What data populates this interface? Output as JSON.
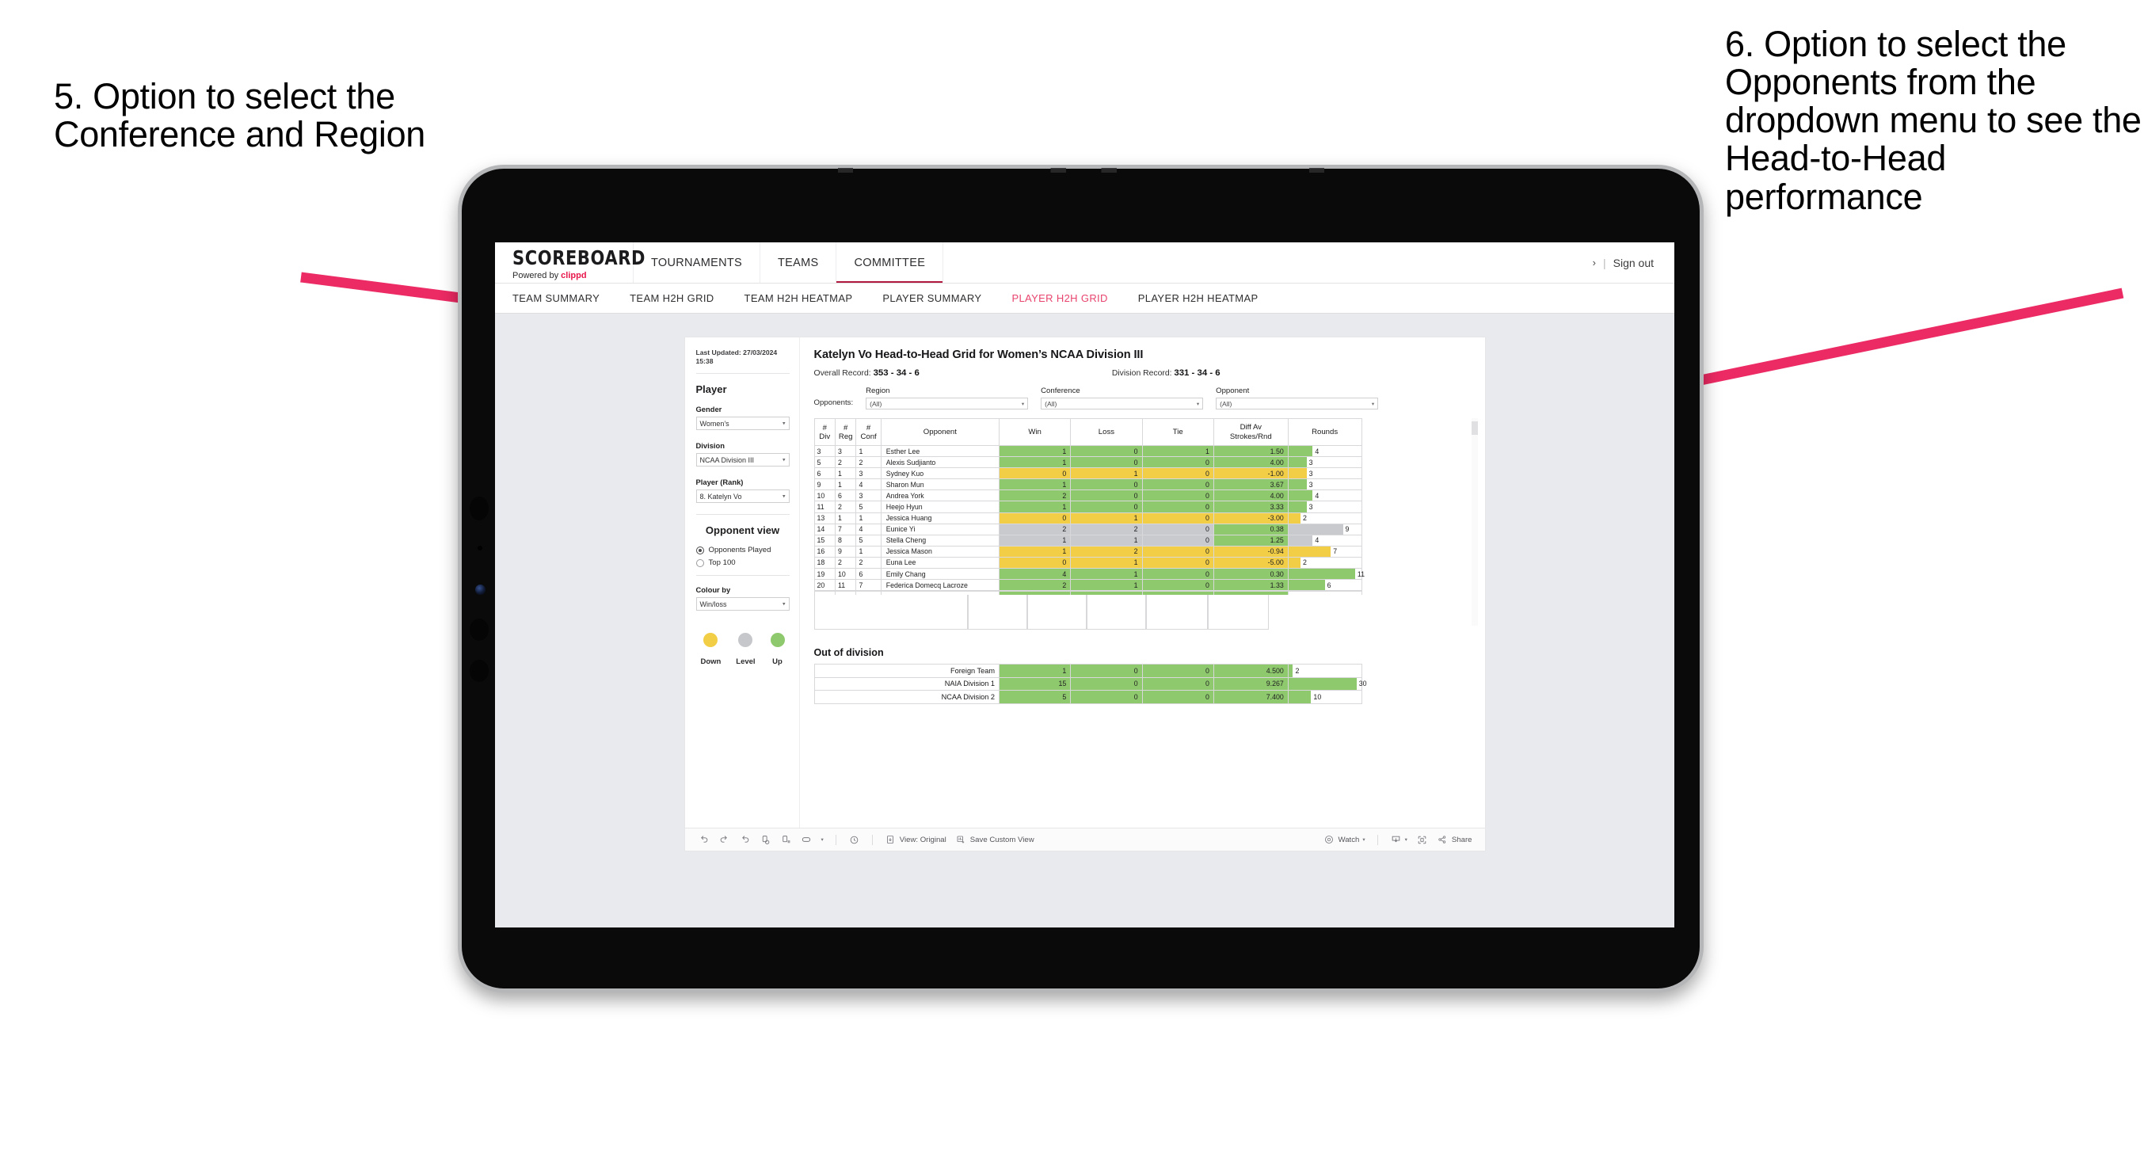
{
  "annotations": {
    "left": "5. Option to select the Conference and Region",
    "right": "6. Option to select the Opponents from the dropdown menu to see the Head-to-Head performance",
    "arrow_color": "#EC2a63"
  },
  "header": {
    "brand_title": "SCOREBOARD",
    "brand_sub_prefix": "Powered by ",
    "brand_sub_brand": "clippd",
    "nav": [
      {
        "label": "TOURNAMENTS",
        "active": false
      },
      {
        "label": "TEAMS",
        "active": false
      },
      {
        "label": "COMMITTEE",
        "active": true
      }
    ],
    "chevron": "›",
    "separator": "|",
    "sign_out": "Sign out"
  },
  "subnav": {
    "items": [
      {
        "label": "TEAM SUMMARY",
        "active": false
      },
      {
        "label": "TEAM H2H GRID",
        "active": false
      },
      {
        "label": "TEAM H2H HEATMAP",
        "active": false
      },
      {
        "label": "PLAYER SUMMARY",
        "active": false
      },
      {
        "label": "PLAYER H2H GRID",
        "active": true
      },
      {
        "label": "PLAYER H2H HEATMAP",
        "active": false
      }
    ],
    "active_color": "#e8446d"
  },
  "sidebar": {
    "last_updated": "Last Updated: 27/03/2024 15:38",
    "player_heading": "Player",
    "gender": {
      "label": "Gender",
      "value": "Women’s"
    },
    "division": {
      "label": "Division",
      "value": "NCAA Division III"
    },
    "player_rank": {
      "label": "Player (Rank)",
      "value": "8. Katelyn Vo"
    },
    "opponent_view": {
      "heading": "Opponent view",
      "options": [
        {
          "label": "Opponents Played",
          "selected": true
        },
        {
          "label": "Top 100",
          "selected": false
        }
      ]
    },
    "colour_by": {
      "label": "Colour by",
      "value": "Win/loss"
    },
    "legend": [
      {
        "caption": "Down",
        "color": "#F2CE46"
      },
      {
        "caption": "Level",
        "color": "#C5C7CB"
      },
      {
        "caption": "Up",
        "color": "#8FC96D"
      }
    ]
  },
  "main": {
    "title": "Katelyn Vo Head-to-Head Grid for Women’s NCAA Division III",
    "overall_record_label": "Overall Record:",
    "overall_record_value": "353 - 34 - 6",
    "division_record_label": "Division Record:",
    "division_record_value": "331 - 34 - 6",
    "opponents_label": "Opponents:",
    "filters": [
      {
        "label": "Region",
        "value": "(All)"
      },
      {
        "label": "Conference",
        "value": "(All)"
      },
      {
        "label": "Opponent",
        "value": "(All)"
      }
    ]
  },
  "chart_data": {
    "type": "table",
    "title": "Katelyn Vo Head-to-Head Grid for Women’s NCAA Division III",
    "columns": [
      "# Div",
      "# Reg",
      "# Conf",
      "Opponent",
      "Win",
      "Loss",
      "Tie",
      "Diff Av Strokes/Rnd",
      "Rounds"
    ],
    "rounds_max": 12,
    "rows": [
      {
        "div": "3",
        "reg": "3",
        "conf": "1",
        "opponent": "Esther Lee",
        "win": "1",
        "loss": "0",
        "tie": "1",
        "diff": "1.50",
        "rounds": "4",
        "color": "g"
      },
      {
        "div": "5",
        "reg": "2",
        "conf": "2",
        "opponent": "Alexis Sudjianto",
        "win": "1",
        "loss": "0",
        "tie": "0",
        "diff": "4.00",
        "rounds": "3",
        "color": "g"
      },
      {
        "div": "6",
        "reg": "1",
        "conf": "3",
        "opponent": "Sydney Kuo",
        "win": "0",
        "loss": "1",
        "tie": "0",
        "diff": "-1.00",
        "rounds": "3",
        "color": "y"
      },
      {
        "div": "9",
        "reg": "1",
        "conf": "4",
        "opponent": "Sharon Mun",
        "win": "1",
        "loss": "0",
        "tie": "0",
        "diff": "3.67",
        "rounds": "3",
        "color": "g"
      },
      {
        "div": "10",
        "reg": "6",
        "conf": "3",
        "opponent": "Andrea York",
        "win": "2",
        "loss": "0",
        "tie": "0",
        "diff": "4.00",
        "rounds": "4",
        "color": "g"
      },
      {
        "div": "11",
        "reg": "2",
        "conf": "5",
        "opponent": "Heejo Hyun",
        "win": "1",
        "loss": "0",
        "tie": "0",
        "diff": "3.33",
        "rounds": "3",
        "color": "g"
      },
      {
        "div": "13",
        "reg": "1",
        "conf": "1",
        "opponent": "Jessica Huang",
        "win": "0",
        "loss": "1",
        "tie": "0",
        "diff": "-3.00",
        "rounds": "2",
        "color": "y"
      },
      {
        "div": "14",
        "reg": "7",
        "conf": "4",
        "opponent": "Eunice Yi",
        "win": "2",
        "loss": "2",
        "tie": "0",
        "diff": "0.38",
        "rounds": "9",
        "color": "gr",
        "diff_color": "g"
      },
      {
        "div": "15",
        "reg": "8",
        "conf": "5",
        "opponent": "Stella Cheng",
        "win": "1",
        "loss": "1",
        "tie": "0",
        "diff": "1.25",
        "rounds": "4",
        "color": "gr",
        "diff_color": "g"
      },
      {
        "div": "16",
        "reg": "9",
        "conf": "1",
        "opponent": "Jessica Mason",
        "win": "1",
        "loss": "2",
        "tie": "0",
        "diff": "-0.94",
        "rounds": "7",
        "color": "y"
      },
      {
        "div": "18",
        "reg": "2",
        "conf": "2",
        "opponent": "Euna Lee",
        "win": "0",
        "loss": "1",
        "tie": "0",
        "diff": "-5.00",
        "rounds": "2",
        "color": "y"
      },
      {
        "div": "19",
        "reg": "10",
        "conf": "6",
        "opponent": "Emily Chang",
        "win": "4",
        "loss": "1",
        "tie": "0",
        "diff": "0.30",
        "rounds": "11",
        "color": "g"
      },
      {
        "div": "20",
        "reg": "11",
        "conf": "7",
        "opponent": "Federica Domecq Lacroze",
        "win": "2",
        "loss": "1",
        "tie": "0",
        "diff": "1.33",
        "rounds": "6",
        "color": "g"
      }
    ],
    "out_of_division": {
      "title": "Out of division",
      "rounds_max": 32,
      "rows": [
        {
          "label": "Foreign Team",
          "win": "1",
          "loss": "0",
          "tie": "0",
          "diff": "4.500",
          "rounds": "2",
          "color": "g"
        },
        {
          "label": "NAIA Division 1",
          "win": "15",
          "loss": "0",
          "tie": "0",
          "diff": "9.267",
          "rounds": "30",
          "color": "g"
        },
        {
          "label": "NCAA Division 2",
          "win": "5",
          "loss": "0",
          "tie": "0",
          "diff": "7.400",
          "rounds": "10",
          "color": "g"
        }
      ]
    }
  },
  "toolbar": {
    "view_label": "View: Original",
    "save_label": "Save Custom View",
    "watch_label": "Watch",
    "share_label": "Share",
    "caret": "▾"
  }
}
